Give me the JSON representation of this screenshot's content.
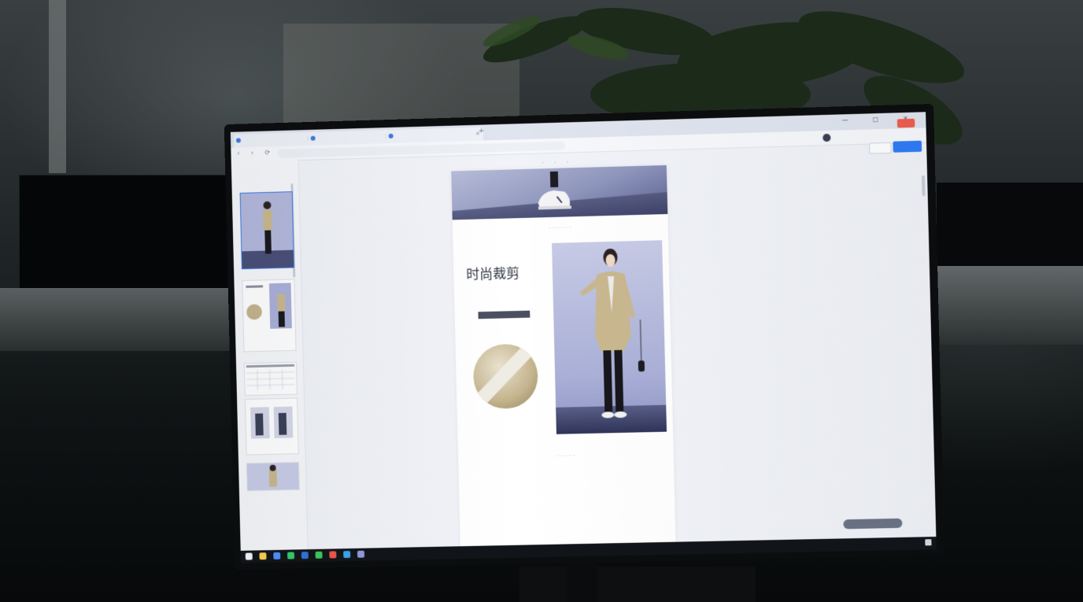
{
  "browser": {
    "tabs": [
      {
        "label": ""
      },
      {
        "label": ""
      },
      {
        "label": ""
      }
    ],
    "new_tab_symbol": "+",
    "window_controls": "— ▢ ✕",
    "nav_symbols": "‹ › ⟳",
    "url": ""
  },
  "app": {
    "logo": "",
    "account_button": "",
    "preview_button": "",
    "save_button": "",
    "header_link": ""
  },
  "sidebar": {
    "title": "",
    "subtitle": ""
  },
  "canvas": {
    "section_1_title": "",
    "headline_small": "",
    "headline": "时尚裁剪",
    "subline": "",
    "tag_pill": "",
    "tag_description": "",
    "section_2_title": "",
    "params": [
      {
        "text": ""
      },
      {
        "text": ""
      },
      {
        "text": ""
      }
    ]
  },
  "right_panel": {
    "title": "",
    "row": ""
  },
  "zoom_control": "",
  "taskbar": {
    "tray_text": "",
    "clock": ""
  },
  "colors": {
    "accent": "#2f7cf6",
    "account_red": "#f05d4e",
    "photo_backdrop": "#aab0d8",
    "coat_beige": "#c4b48d"
  }
}
